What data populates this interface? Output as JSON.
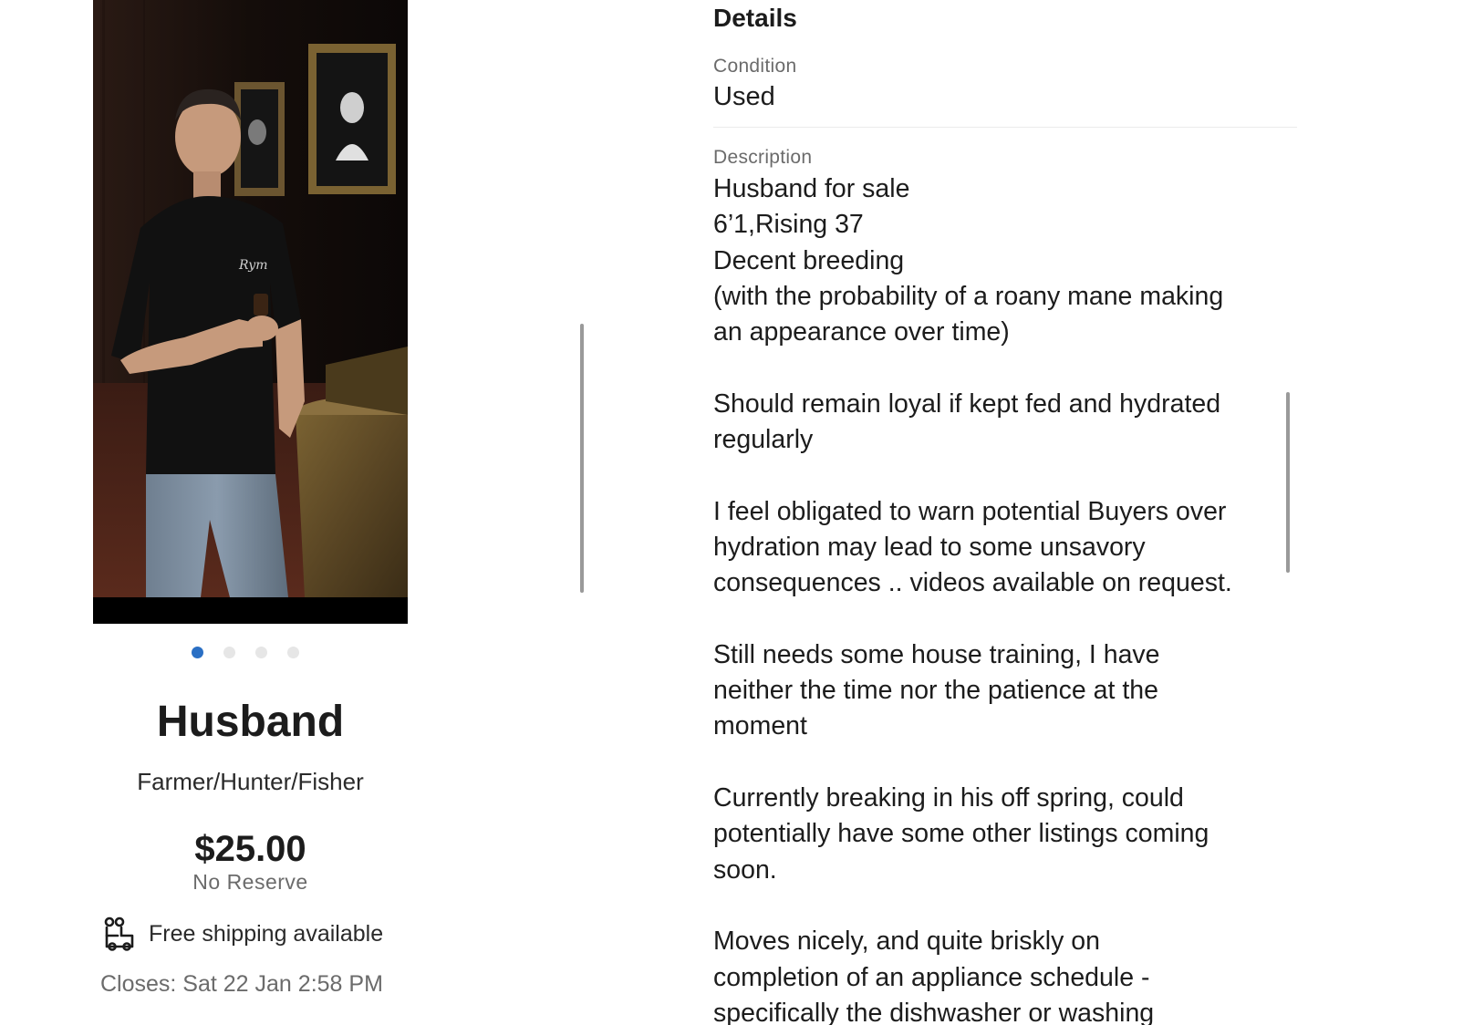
{
  "listing": {
    "title": "Husband",
    "subtitle": "Farmer/Hunter/Fisher",
    "price": "$25.00",
    "reserve": "No Reserve",
    "shipping": "Free shipping available",
    "closes": "Closes: Sat 22 Jan 2:58 PM",
    "photo": {
      "shirt_logo": "Rym"
    },
    "carousel": {
      "count": 4,
      "active_index": 0,
      "active_color": "#2a6fc4",
      "inactive_color": "#e6e6e6"
    }
  },
  "details": {
    "heading": "Details",
    "condition_label": "Condition",
    "condition_value": "Used",
    "description_label": "Description",
    "description": [
      [
        "Husband for sale",
        "6’1,Rising 37",
        "Decent breeding",
        "(with the probability of a roany mane making",
        "an appearance over time)"
      ],
      [
        "Should remain loyal if kept fed and hydrated",
        "regularly"
      ],
      [
        "I feel obligated to warn potential Buyers over",
        "hydration may lead to some unsavory",
        "consequences .. videos available on request."
      ],
      [
        "Still needs some house training, I have",
        "neither the time nor the patience at the",
        "moment"
      ],
      [
        "Currently breaking in his off spring, could",
        "potentially have some other listings coming",
        "soon."
      ],
      [
        "Moves nicely, and quite briskly on",
        "completion of an appliance schedule -",
        "specifically the dishwasher or washing"
      ]
    ]
  },
  "icons": {
    "shipping": "truck-icon"
  }
}
